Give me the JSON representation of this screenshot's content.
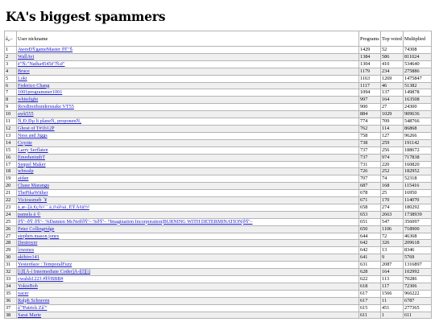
{
  "page": {
    "title": "KA's biggest spammers"
  },
  "table": {
    "headers": {
      "rank": "â„–",
      "nickname": "User nickname",
      "programs": "Programs",
      "top_voted": "Top voted",
      "multiplied": "Multiplied"
    },
    "rows": [
      {
        "rank": "1",
        "nickname": "AwesÐŸgameMaster ðŸ\"Š",
        "programs": "1429",
        "top": "52",
        "mult": "74308"
      },
      {
        "rank": "2",
        "nickname": "WallAvi",
        "programs": "1384",
        "top": "586",
        "mult": "811024"
      },
      {
        "rank": "3",
        "nickname": "ë\"Ñ‹\"Natha4545ë\"Ñ‹ë\"",
        "programs": "1304",
        "top": "410",
        "mult": "534640"
      },
      {
        "rank": "4",
        "nickname": "Bruce",
        "programs": "1179",
        "top": "234",
        "mult": "275886"
      },
      {
        "rank": "5",
        "nickname": "Loki",
        "programs": "1163",
        "top": "1269",
        "mult": "1475847"
      },
      {
        "rank": "6",
        "nickname": "Federico Chang",
        "programs": "1117",
        "top": "46",
        "mult": "51382"
      },
      {
        "rank": "7",
        "nickname": "1001programmer1001",
        "programs": "1094",
        "top": "137",
        "mult": "149878"
      },
      {
        "rank": "8",
        "nickname": "whitelight",
        "programs": "997",
        "top": "164",
        "mult": "163508"
      },
      {
        "rank": "9",
        "nickname": "Rexdinothundersnake VT55",
        "programs": "900",
        "top": "27",
        "mult": "24300"
      },
      {
        "rank": "10",
        "nickname": "awk555",
        "programs": "884",
        "top": "1029",
        "mult": "909636"
      },
      {
        "rank": "11",
        "nickname": "Ñ‚Ð¸Ðµ lt planeÑ‚ proponenÑ‚",
        "programs": "774",
        "top": "709",
        "mult": "548766"
      },
      {
        "rank": "12",
        "nickname": "Ghost of T#1b12P",
        "programs": "762",
        "top": "114",
        "mult": "86868"
      },
      {
        "rank": "13",
        "nickname": "Ness and Jiggs",
        "programs": "758",
        "top": "127",
        "mult": "96266"
      },
      {
        "rank": "14",
        "nickname": "Coyote",
        "programs": "738",
        "top": "259",
        "mult": "191142"
      },
      {
        "rank": "15",
        "nickname": "Larry Serflaten",
        "programs": "737",
        "top": "256",
        "mult": "188672"
      },
      {
        "rank": "16",
        "nickname": "EmeduniuthT",
        "programs": "737",
        "top": "974",
        "mult": "717838"
      },
      {
        "rank": "17",
        "nickname": "Sequel Maker",
        "programs": "731",
        "top": "220",
        "mult": "160820"
      },
      {
        "rank": "18",
        "nickname": "wbwalp",
        "programs": "726",
        "top": "252",
        "mult": "182952"
      },
      {
        "rank": "19",
        "nickname": "aidan",
        "programs": "707",
        "top": "74",
        "mult": "52318"
      },
      {
        "rank": "20",
        "nickname": "Chase Marangu",
        "programs": "687",
        "top": "168",
        "mult": "115416"
      },
      {
        "rank": "21",
        "nickname": "ThePikaWither",
        "programs": "678",
        "top": "25",
        "mult": "16950"
      },
      {
        "rank": "22",
        "nickname": "Viciousmeb    ´¥",
        "programs": "671",
        "top": "170",
        "mult": "114070"
      },
      {
        "rank": "23",
        "nickname": "ä¸­æ–‡ä¸€ç¾¤¨¨ ä¸­ï¼š¼ä¸­ ÈŸÂ¢ä½²",
        "programs": "658",
        "top": "274",
        "mult": "180292"
      },
      {
        "rank": "24",
        "nickname": "pamela ä   ©",
        "programs": "653",
        "top": "2663",
        "mult": "1738939"
      },
      {
        "rank": "25",
        "nickname": "ðŸ'–ðŸ     ðŸ'–    %Damien McNeffðŸ'–    %ðŸ'–    °Imagination Incorporation|BURNING WITH DETERMINATION|ðŸ'–",
        "programs": "651",
        "top": "547",
        "mult": "356097"
      },
      {
        "rank": "26",
        "nickname": "Peter Collingridge",
        "programs": "650",
        "top": "1106",
        "mult": "718900"
      },
      {
        "rank": "27",
        "nickname": "stephen.mason.jones",
        "programs": "644",
        "top": "72",
        "mult": "46368"
      },
      {
        "rank": "28",
        "nickname": "Destroyer",
        "programs": "642",
        "top": "326",
        "mult": "209618"
      },
      {
        "rank": "29",
        "nickname": "lowenes",
        "programs": "642",
        "top": "13",
        "mult": "8346"
      },
      {
        "rank": "30",
        "nickname": "akihiro141",
        "programs": "641",
        "top": "9",
        "mult": "5769"
      },
      {
        "rank": "31",
        "nickname": "Yesterdaze : TemporalFuzz",
        "programs": "631",
        "top": "2087",
        "mult": "1316897"
      },
      {
        "rank": "32",
        "nickname": "[ì]Î[Ã-í Intermediate Coder]Ã-í[Î][ì]",
        "programs": "628",
        "top": "164",
        "mult": "102992"
      },
      {
        "rank": "33",
        "nickname": "cwalsh1223 #Ï®BBB#",
        "programs": "622",
        "top": "113",
        "mult": "70286"
      },
      {
        "rank": "34",
        "nickname": "YokieBob",
        "programs": "618",
        "top": "117",
        "mult": "72306"
      },
      {
        "rank": "35",
        "nickname": "xacer",
        "programs": "617",
        "top": "1566",
        "mult": "966222"
      },
      {
        "rank": "36",
        "nickname": "Ralph Schraven",
        "programs": "617",
        "top": "11",
        "mult": "6787"
      },
      {
        "rank": "37",
        "nickname": "â˜ºPatrick Zâ˜º",
        "programs": "615",
        "top": "451",
        "mult": "277365"
      },
      {
        "rank": "38",
        "nickname": "Sarai Marte",
        "programs": "611",
        "top": "1",
        "mult": "611"
      }
    ]
  }
}
